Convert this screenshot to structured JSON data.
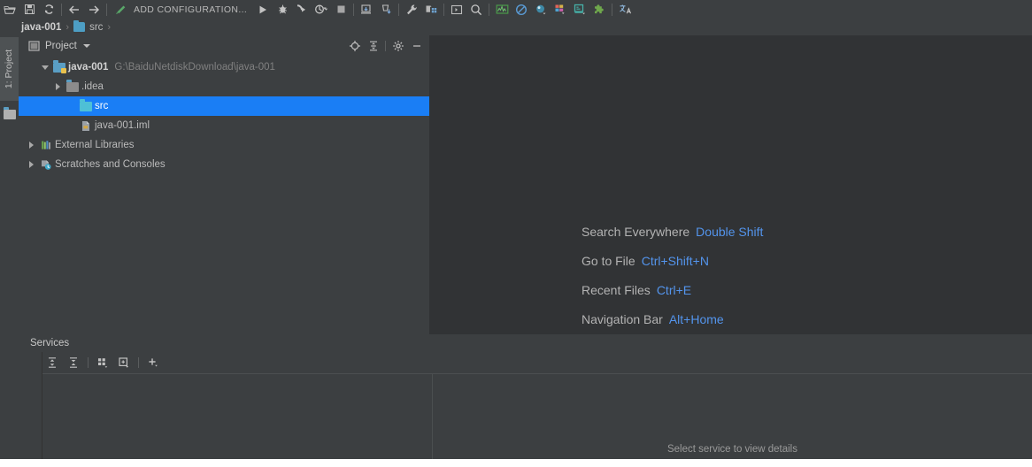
{
  "window": {
    "ide": "IntelliJ IDEA",
    "bg_editor": "#313335",
    "bg_panel": "#3c3f41",
    "accent_selection": "#1a7ef5",
    "accent_link": "#5394ec"
  },
  "toolbar": {
    "add_configuration_label": "ADD CONFIGURATION...",
    "icons": [
      {
        "name": "open-project-icon",
        "title": "Open"
      },
      {
        "name": "save-all-icon",
        "title": "Save All"
      },
      {
        "name": "sync-icon",
        "title": "Synchronize"
      },
      {
        "name": "back-icon",
        "title": "Back"
      },
      {
        "name": "forward-icon",
        "title": "Forward"
      },
      {
        "name": "build-icon",
        "title": "Build Project"
      },
      {
        "name": "run-icon",
        "title": "Run"
      },
      {
        "name": "debug-icon",
        "title": "Debug"
      },
      {
        "name": "run-coverage-icon",
        "title": "Run with Coverage"
      },
      {
        "name": "profiler-icon",
        "title": "Profile"
      },
      {
        "name": "stop-icon",
        "title": "Stop"
      },
      {
        "name": "update-project-icon",
        "title": "Update Project"
      },
      {
        "name": "commit-icon",
        "title": "Commit"
      },
      {
        "name": "settings-wrench-icon",
        "title": "Settings"
      },
      {
        "name": "project-structure-icon",
        "title": "Project Structure"
      },
      {
        "name": "terminal-icon",
        "title": "Terminal"
      },
      {
        "name": "search-icon",
        "title": "Search Everywhere"
      },
      {
        "name": "monitor-graph-icon",
        "title": "Monitor"
      },
      {
        "name": "no-entry-icon",
        "title": "Mute"
      },
      {
        "name": "database-icon",
        "title": "Database"
      },
      {
        "name": "chart-icon",
        "title": "Diagram"
      },
      {
        "name": "ui-designer-icon",
        "title": "UI Designer"
      },
      {
        "name": "plugin-icon",
        "title": "Plugins"
      },
      {
        "name": "translate-icon",
        "title": "Translate"
      }
    ]
  },
  "breadcrumb": {
    "items": [
      {
        "label": "java-001",
        "bold": true,
        "icon": null
      },
      {
        "label": "src",
        "bold": false,
        "icon": "folder-icon"
      }
    ],
    "separator": "›"
  },
  "left_strip": {
    "tab_label": "1: Project",
    "bottom_icon": "folder-icon"
  },
  "project_panel": {
    "title": "Project",
    "dropdown_caret": "▾",
    "header_actions": [
      {
        "name": "locate-target-icon",
        "title": "Select Opened File"
      },
      {
        "name": "collapse-all-icon",
        "title": "Collapse All"
      },
      {
        "name": "gear-icon",
        "title": "Settings"
      },
      {
        "name": "minimize-icon",
        "title": "Hide"
      }
    ],
    "tree": [
      {
        "label": "java-001",
        "path": "G:\\BaiduNetdiskDownload\\java-001",
        "indent": 0,
        "expanded": true,
        "has_arrow": true,
        "icon": "module-folder-icon",
        "bold": true,
        "selected": false
      },
      {
        "label": ".idea",
        "path": "",
        "indent": 1,
        "expanded": false,
        "has_arrow": true,
        "icon": "folder-icon",
        "bold": false,
        "selected": false
      },
      {
        "label": "src",
        "path": "",
        "indent": 2,
        "expanded": false,
        "has_arrow": false,
        "icon": "source-folder-icon",
        "bold": false,
        "selected": true
      },
      {
        "label": "java-001.iml",
        "path": "",
        "indent": 2,
        "expanded": false,
        "has_arrow": false,
        "icon": "iml-file-icon",
        "bold": false,
        "selected": false
      },
      {
        "label": "External Libraries",
        "path": "",
        "indent": 0,
        "expanded": false,
        "has_arrow": true,
        "icon": "libraries-icon",
        "bold": false,
        "selected": false
      },
      {
        "label": "Scratches and Consoles",
        "path": "",
        "indent": 0,
        "expanded": false,
        "has_arrow": true,
        "icon": "scratches-icon",
        "bold": false,
        "selected": false
      }
    ]
  },
  "editor": {
    "hints": [
      {
        "label": "Search Everywhere",
        "shortcut": "Double Shift"
      },
      {
        "label": "Go to File",
        "shortcut": "Ctrl+Shift+N"
      },
      {
        "label": "Recent Files",
        "shortcut": "Ctrl+E"
      },
      {
        "label": "Navigation Bar",
        "shortcut": "Alt+Home"
      }
    ]
  },
  "services": {
    "tab_label": "Services",
    "toolbar_icons": [
      {
        "name": "expand-all-icon",
        "title": "Expand All"
      },
      {
        "name": "collapse-all-icon",
        "title": "Collapse All"
      },
      {
        "name": "group-by-icon",
        "title": "Group By"
      },
      {
        "name": "add-configuration-icon",
        "title": "Add Configuration"
      },
      {
        "name": "add-icon",
        "title": "Add"
      }
    ],
    "detail_placeholder": "Select service to view details"
  }
}
